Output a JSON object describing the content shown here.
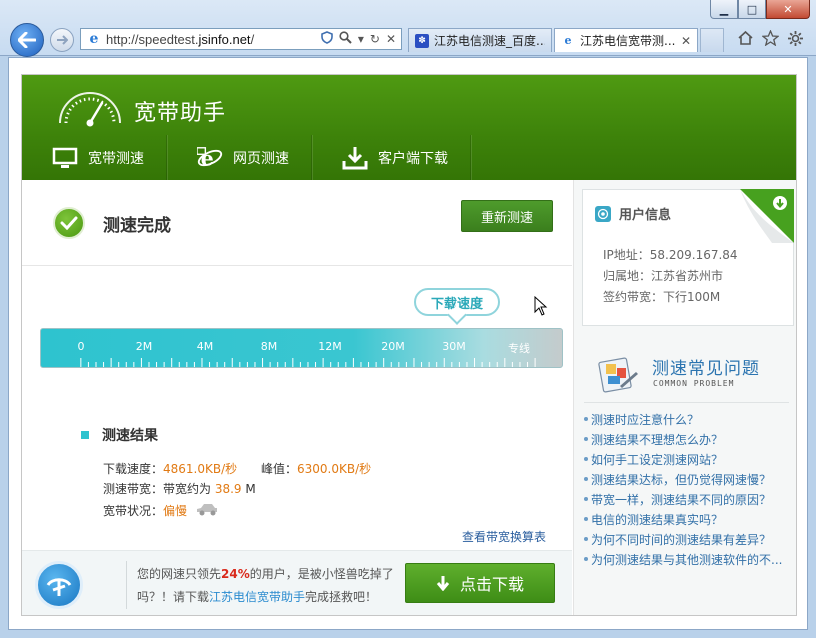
{
  "browser": {
    "url_prefix": "http://speedtest.",
    "url_domain": "jsinfo.net",
    "url_suffix": "/",
    "tabs": [
      {
        "title": "江苏电信测速_百度..."
      },
      {
        "title": "江苏电信宽带测...",
        "close": "✕"
      }
    ],
    "window_buttons": {
      "minimize": "▁",
      "maximize": "□",
      "close": "✕"
    }
  },
  "app": {
    "brand": "宽带助手",
    "nav": [
      {
        "label": "宽带测速"
      },
      {
        "label": "网页测速"
      },
      {
        "label": "客户端下载"
      }
    ],
    "status": "测速完成",
    "retest_label": "重新测速",
    "speed_bubble": "下载速度",
    "gauge_labels": [
      "0",
      "2M",
      "4M",
      "8M",
      "12M",
      "20M",
      "30M",
      "专线"
    ],
    "result": {
      "title": "测速结果",
      "download_label": "下载速度：",
      "download_value": "4861.0KB/秒",
      "peak_label": "峰值：",
      "peak_value": "6300.0KB/秒",
      "bandwidth_label": "测速带宽：带宽约为 ",
      "bandwidth_value": "38.9",
      "bandwidth_unit": " M",
      "state_label": "宽带状况：",
      "state_value": "偏慢",
      "calc_link": "查看带宽换算表"
    },
    "promo": {
      "text_a": "您的网速只领先",
      "pct": "24%",
      "text_b": "的用户，是被小怪兽吃掉了吗？！请下载",
      "app_name": "江苏电信宽带助手",
      "text_c": "完成拯救吧！",
      "download_label": "点击下载"
    },
    "user_info": {
      "title": "用户信息",
      "ip": "IP地址：58.209.167.84",
      "location": "归属地：江苏省苏州市",
      "bandwidth": "签约带宽：下行100M"
    },
    "faq": {
      "title": "测速常见问题",
      "subtitle": "COMMON PROBLEM",
      "items": [
        "测速时应注意什么？",
        "测速结果不理想怎么办？",
        "如何手工设定测速网站？",
        "测速结果达标，但仍觉得网速慢？",
        "带宽一样，测速结果不同的原因？",
        "电信的测速结果真实吗？",
        "为何不同时间的测速结果有差异？",
        "为何测速结果与其他测速软件的不..."
      ]
    }
  },
  "colors": {
    "header_green": "#3d820a",
    "accent_cyan": "#2ec3cf",
    "value_orange": "#e17a14",
    "link_blue": "#3270a8"
  }
}
